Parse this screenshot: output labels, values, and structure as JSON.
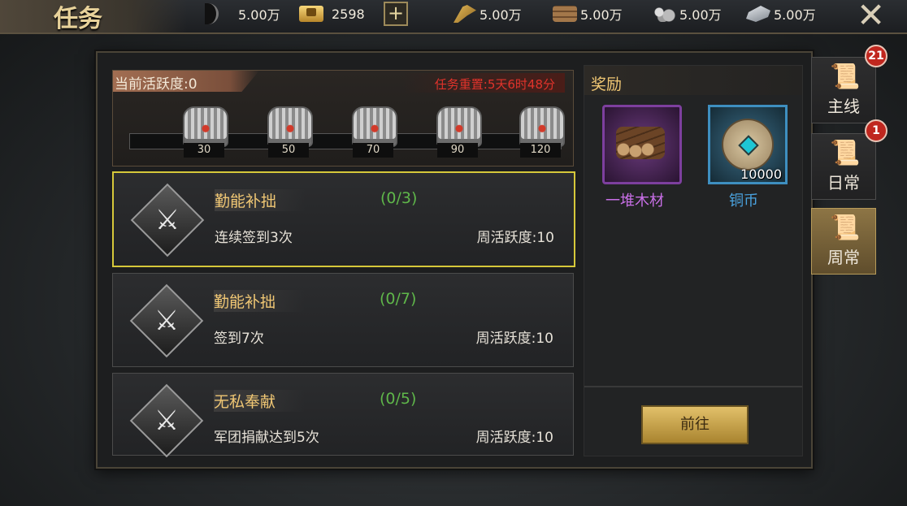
{
  "header": {
    "title": "任务",
    "resources": [
      {
        "icon": "moon-icon",
        "value": "5.00万"
      },
      {
        "icon": "gold-ingot-icon",
        "value": "2598"
      },
      {
        "icon": "grain-icon",
        "value": "5.00万"
      },
      {
        "icon": "wood-icon",
        "value": "5.00万"
      },
      {
        "icon": "stone-icon",
        "value": "5.00万"
      },
      {
        "icon": "iron-icon",
        "value": "5.00万"
      }
    ],
    "plus_label": "+",
    "close_label": "✕"
  },
  "activity": {
    "current_label": "当前活跃度:0",
    "reset_label": "任务重置:5天6时48分",
    "milestones": [
      "30",
      "50",
      "70",
      "90",
      "120"
    ]
  },
  "tasks": [
    {
      "name": "勤能补拙",
      "progress": "(0/3)",
      "desc": "连续签到3次",
      "reward": "周活跃度:10"
    },
    {
      "name": "勤能补拙",
      "progress": "(0/7)",
      "desc": "签到7次",
      "reward": "周活跃度:10"
    },
    {
      "name": "无私奉献",
      "progress": "(0/5)",
      "desc": "军团捐献达到5次",
      "reward": "周活跃度:10"
    }
  ],
  "rewards": {
    "heading": "奖励",
    "items": [
      {
        "name": "一堆木材",
        "qty": "",
        "color": "#c86fe6"
      },
      {
        "name": "铜币",
        "qty": "10000",
        "color": "#4aa3e0"
      }
    ],
    "go_label": "前往"
  },
  "tabs": [
    {
      "label": "主线",
      "badge": "21"
    },
    {
      "label": "日常",
      "badge": "1"
    },
    {
      "label": "周常",
      "badge": ""
    }
  ],
  "colors": {
    "accent_gold": "#f0c774",
    "progress_green": "#5fb74a",
    "reset_red": "#e0332b",
    "selected_border": "#d6c83a"
  }
}
